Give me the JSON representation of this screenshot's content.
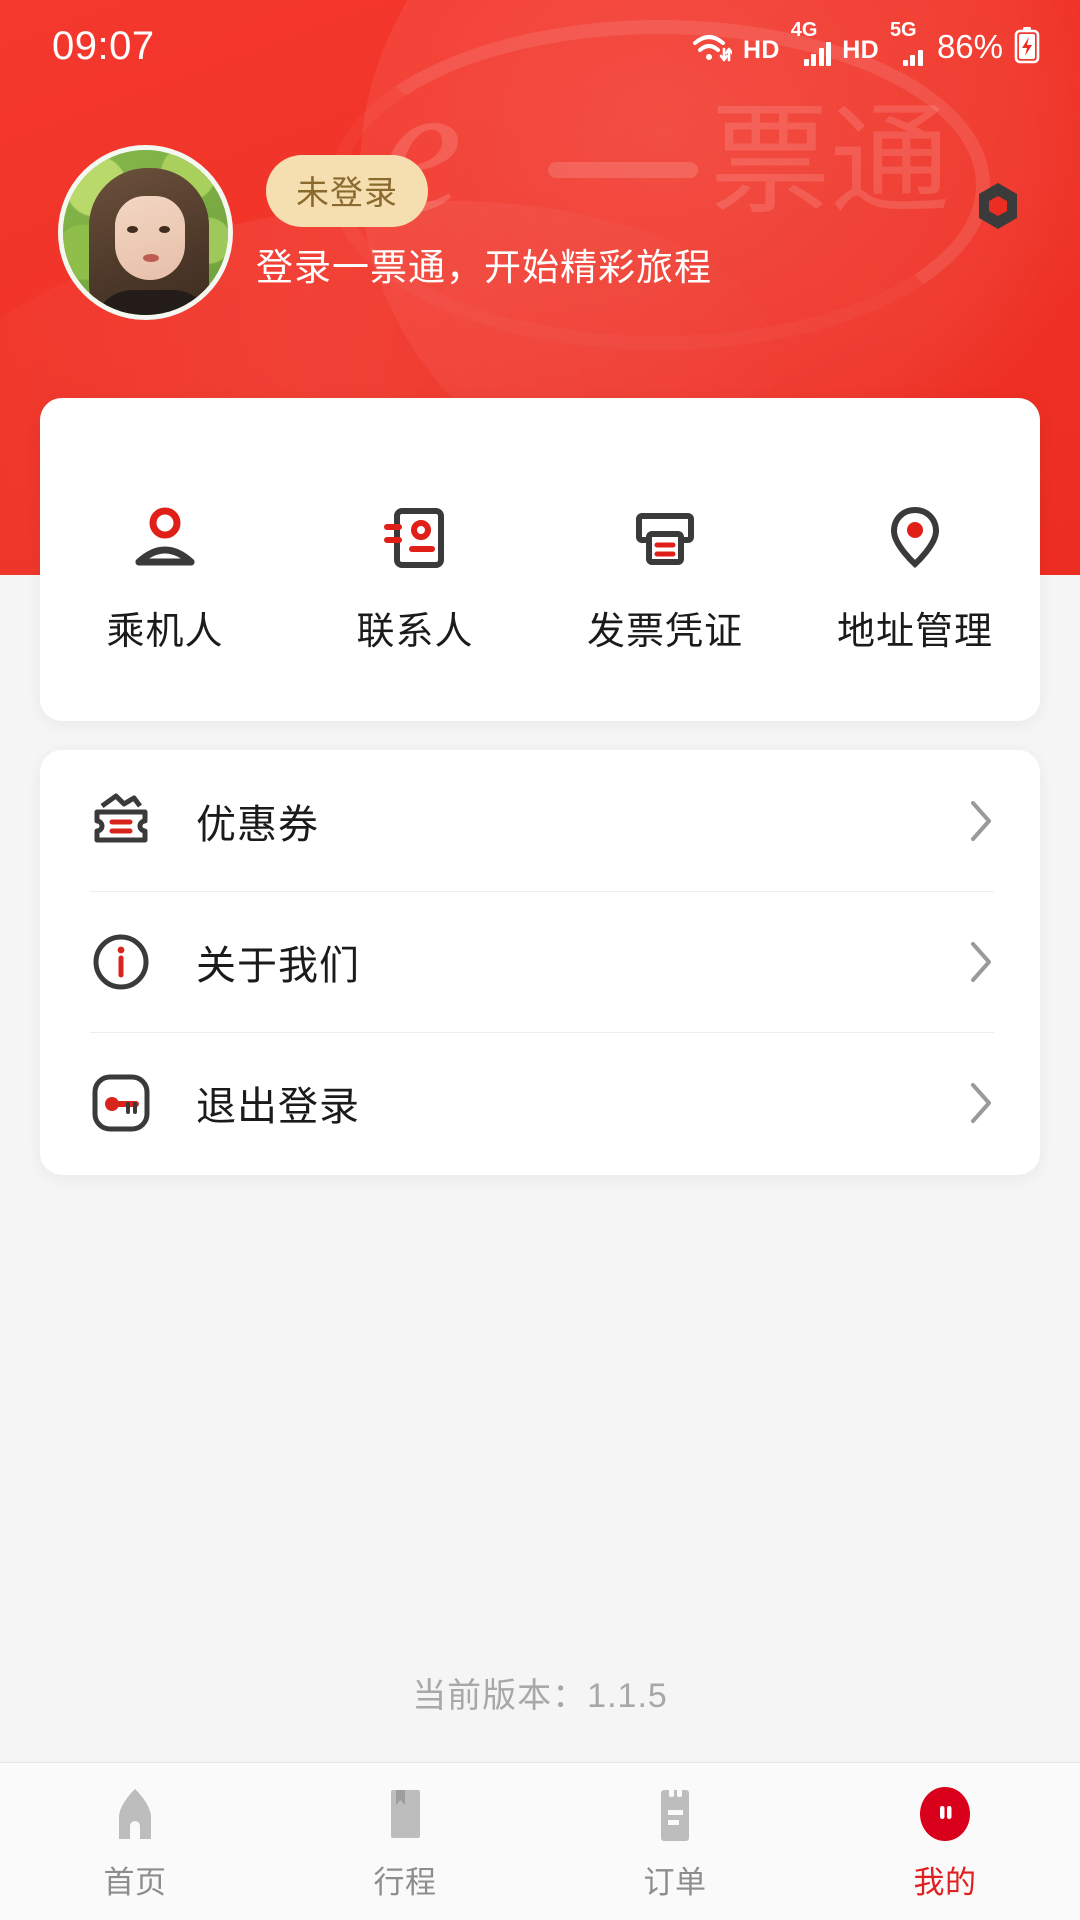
{
  "statusbar": {
    "time": "09:07",
    "wifi_icon": "wifi-icon",
    "hd1_label": "HD",
    "net1_label": "4G",
    "hd2_label": "HD",
    "net2_label": "5G",
    "battery_label": "86%",
    "battery_icon": "battery-charging-icon"
  },
  "header": {
    "brand_watermark": "E一票通",
    "accent_color": "#ec2d22",
    "badge_color": "#f5deb0",
    "hex_icon": "hexagon-icon"
  },
  "profile": {
    "avatar": "user-avatar-photo",
    "login_badge": "未登录",
    "subtitle": "登录一票通，开始精彩旅程"
  },
  "quick_actions": [
    {
      "label": "乘机人",
      "icon": "passenger-icon"
    },
    {
      "label": "联系人",
      "icon": "contacts-book-icon"
    },
    {
      "label": "发票凭证",
      "icon": "invoice-printer-icon"
    },
    {
      "label": "地址管理",
      "icon": "location-pin-icon"
    }
  ],
  "menu": [
    {
      "label": "优惠券",
      "icon": "coupon-icon",
      "chevron": "chevron-right-icon"
    },
    {
      "label": "关于我们",
      "icon": "info-circle-icon",
      "chevron": "chevron-right-icon"
    },
    {
      "label": "退出登录",
      "icon": "logout-key-icon",
      "chevron": "chevron-right-icon"
    }
  ],
  "version": {
    "text": "当前版本：1.1.5"
  },
  "tabbar": {
    "active_color": "#e02020",
    "inactive_color": "#8d8d8d",
    "items": [
      {
        "label": "首页",
        "icon": "home-icon",
        "active": false
      },
      {
        "label": "行程",
        "icon": "trip-book-icon",
        "active": false
      },
      {
        "label": "订单",
        "icon": "order-list-icon",
        "active": false
      },
      {
        "label": "我的",
        "icon": "profile-icon",
        "active": true
      }
    ]
  }
}
